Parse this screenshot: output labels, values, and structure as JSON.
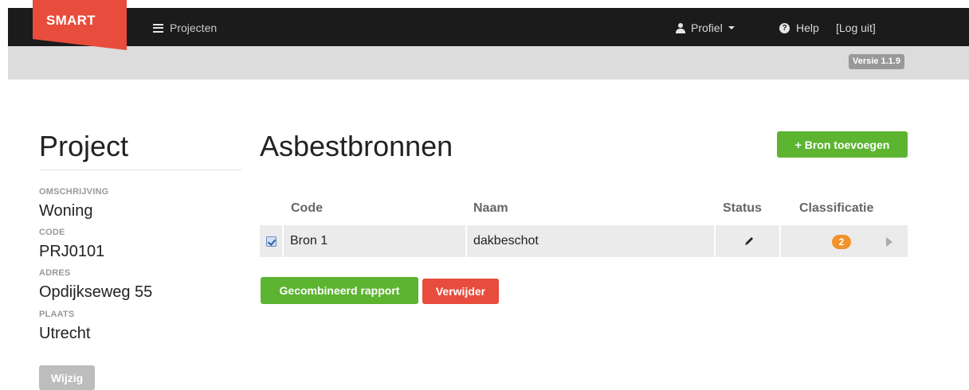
{
  "navbar": {
    "brand": "SMART",
    "projecten": "Projecten",
    "profiel": "Profiel",
    "help": "Help",
    "logout": "[Log uit]",
    "version": "Versie 1.1.9"
  },
  "project": {
    "title": "Project",
    "fields": [
      {
        "label": "OMSCHRIJVING",
        "value": "Woning"
      },
      {
        "label": "CODE",
        "value": "PRJ0101"
      },
      {
        "label": "ADRES",
        "value": "Opdijkseweg 55"
      },
      {
        "label": "PLAATS",
        "value": "Utrecht"
      }
    ],
    "edit_label": "Wijzig"
  },
  "main": {
    "title": "Asbestbronnen",
    "add_label": "+ Bron toevoegen",
    "columns": [
      "Code",
      "Naam",
      "Status",
      "Classificatie"
    ],
    "rows": [
      {
        "code": "Bron 1",
        "naam": "dakbeschot",
        "classificatie_count": "2",
        "checked": true
      }
    ],
    "combined_report_label": "Gecombineerd rapport",
    "delete_label": "Verwijder"
  },
  "colors": {
    "brand": "#e74c3c",
    "success": "#5cb431",
    "danger": "#e74c3c",
    "badge": "#f0932b"
  }
}
